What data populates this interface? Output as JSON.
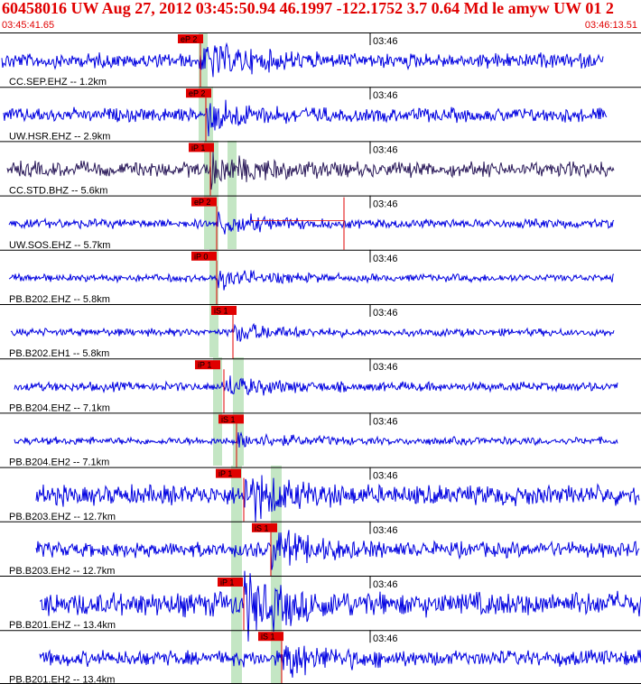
{
  "header": {
    "title": "60458016 UW Aug 27, 2012 03:45:50.94    46.1997 -122.1752  3.7 0.64 Md le amyw UW 01    2",
    "start_time": "03:45:41.65",
    "end_time": "03:46:13.51"
  },
  "minute_label": "03:46",
  "colors": {
    "text": "#000000",
    "accent": "#e00000",
    "trace": "#0000e0",
    "trace_dark": "#2b1a5a",
    "window": "#c4e6c4"
  },
  "traces": [
    {
      "station": "CC.SEP.EHZ -- 1.2km",
      "pick": "eP 2",
      "color": "blue"
    },
    {
      "station": "UW.HSR.EHZ -- 2.9km",
      "pick": "eP 2",
      "color": "blue"
    },
    {
      "station": "CC.STD.BHZ -- 5.6km",
      "pick": "iP 1",
      "color": "dark"
    },
    {
      "station": "UW.SOS.EHZ -- 5.7km",
      "pick": "eP 2",
      "color": "blue"
    },
    {
      "station": "PB.B202.EHZ -- 5.8km",
      "pick": "iP 0",
      "color": "blue"
    },
    {
      "station": "PB.B202.EH1 -- 5.8km",
      "pick": "iS 1",
      "color": "blue"
    },
    {
      "station": "PB.B204.EHZ -- 7.1km",
      "pick": "iP 1",
      "color": "blue"
    },
    {
      "station": "PB.B204.EH2 -- 7.1km",
      "pick": "iS 1",
      "color": "blue"
    },
    {
      "station": "PB.B203.EHZ -- 12.7km",
      "pick": "iP 1",
      "color": "blue"
    },
    {
      "station": "PB.B203.EH2 -- 12.7km",
      "pick": "iS 1",
      "color": "blue"
    },
    {
      "station": "PB.B201.EHZ -- 13.4km",
      "pick": "iP 1",
      "color": "blue"
    },
    {
      "station": "PB.B201.EH2 -- 13.4km",
      "pick": "iS 1",
      "color": "blue"
    }
  ]
}
